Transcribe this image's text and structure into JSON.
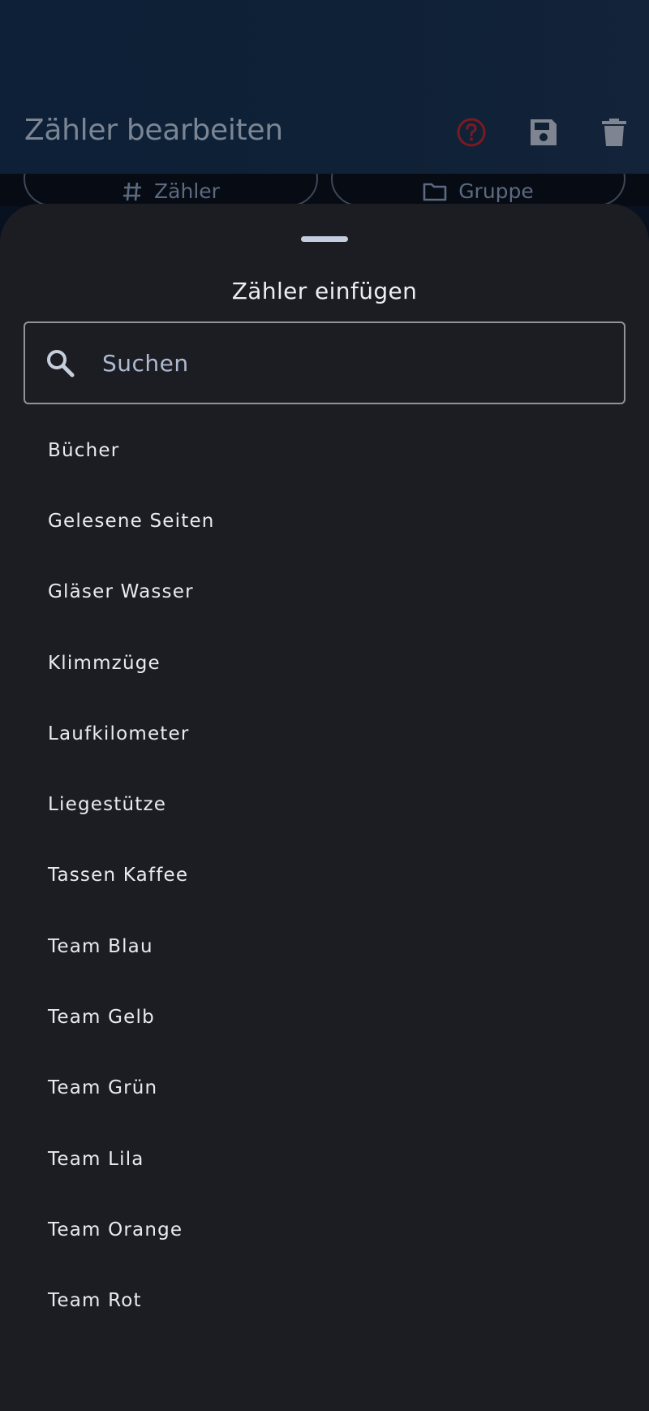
{
  "app_bar": {
    "title": "Zähler bearbeiten",
    "actions": [
      {
        "icon": "help-circle-icon",
        "color": "#7a1a22"
      },
      {
        "icon": "save-icon",
        "color": "#7e8590"
      },
      {
        "icon": "delete-icon",
        "color": "#7e8590"
      }
    ]
  },
  "segments": [
    {
      "label": "Zähler",
      "icon": "hash-icon"
    },
    {
      "label": "Gruppe",
      "icon": "folder-icon"
    }
  ],
  "sheet": {
    "title": "Zähler einfügen",
    "search": {
      "placeholder": "Suchen",
      "value": ""
    },
    "items": [
      "Bücher",
      "Gelesene Seiten",
      "Gläser Wasser",
      "Klimmzüge",
      "Laufkilometer",
      "Liegestütze",
      "Tassen Kaffee",
      "Team Blau",
      "Team Gelb",
      "Team Grün",
      "Team Lila",
      "Team Orange",
      "Team Rot"
    ]
  },
  "colors": {
    "sheet_background": "#1c1d22",
    "app_bar_background": "#0f2136",
    "text_primary": "#e9ebf0",
    "placeholder": "#aeb9d2"
  }
}
